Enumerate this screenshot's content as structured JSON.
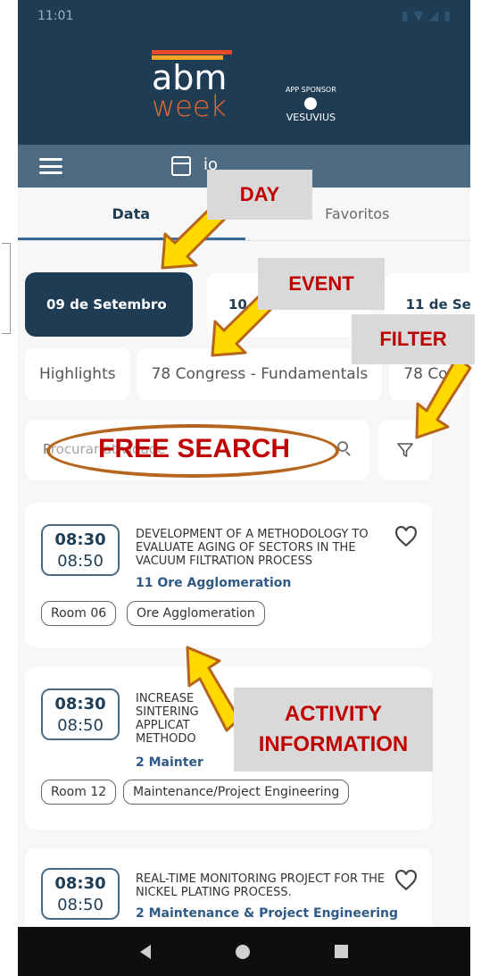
{
  "status": {
    "time": "11:01"
  },
  "header": {
    "logo_top": "abm",
    "logo_bottom": "week",
    "sponsor_label": "APP SPONSOR",
    "sponsor_name": "VESUVIUS"
  },
  "toolbar": {
    "title_fragment": "io"
  },
  "tabs": [
    {
      "label": "Data",
      "active": true
    },
    {
      "label": "Favoritos",
      "active": false
    }
  ],
  "days": [
    {
      "label": "09 de Setembro",
      "active": true
    },
    {
      "label": "10 de Setembro",
      "active": false
    },
    {
      "label": "11 de Se",
      "active": false
    }
  ],
  "events": [
    {
      "label": "Highlights"
    },
    {
      "label": "78 Congress - Fundamentals"
    },
    {
      "label": "78 Co"
    }
  ],
  "search": {
    "placeholder": "Procurar atividade"
  },
  "activities": [
    {
      "start": "08:30",
      "end": "08:50",
      "title": "DEVELOPMENT OF A METHODOLOGY TO EVALUATE AGING OF SECTORS IN THE VACUUM FILTRATION PROCESS",
      "topic": "11 Ore Agglomeration",
      "chips": [
        "Room 06",
        "Ore Agglomeration"
      ]
    },
    {
      "start": "08:30",
      "end": "08:50",
      "title": "INCREASE SINTERING APPLICAT METHODO",
      "topic": "2 Mainter",
      "chips": [
        "Room 12",
        "Maintenance/Project Engineering"
      ]
    },
    {
      "start": "08:30",
      "end": "08:50",
      "title": "REAL-TIME MONITORING PROJECT FOR THE NICKEL PLATING PROCESS.",
      "topic": "2 Maintenance & Project Engineering",
      "chips": []
    }
  ],
  "annotations": {
    "day": "DAY",
    "event": "EVENT",
    "filter": "FILTER",
    "free_search": "FREE SEARCH",
    "activity_line1": "ACTIVITY",
    "activity_line2": "INFORMATION"
  },
  "colors": {
    "primary": "#1f3c55",
    "toolbar": "#4c6a82",
    "accent_orange": "#e6692e",
    "annotation_red": "#c00000",
    "arrow_yellow": "#ffd800"
  }
}
